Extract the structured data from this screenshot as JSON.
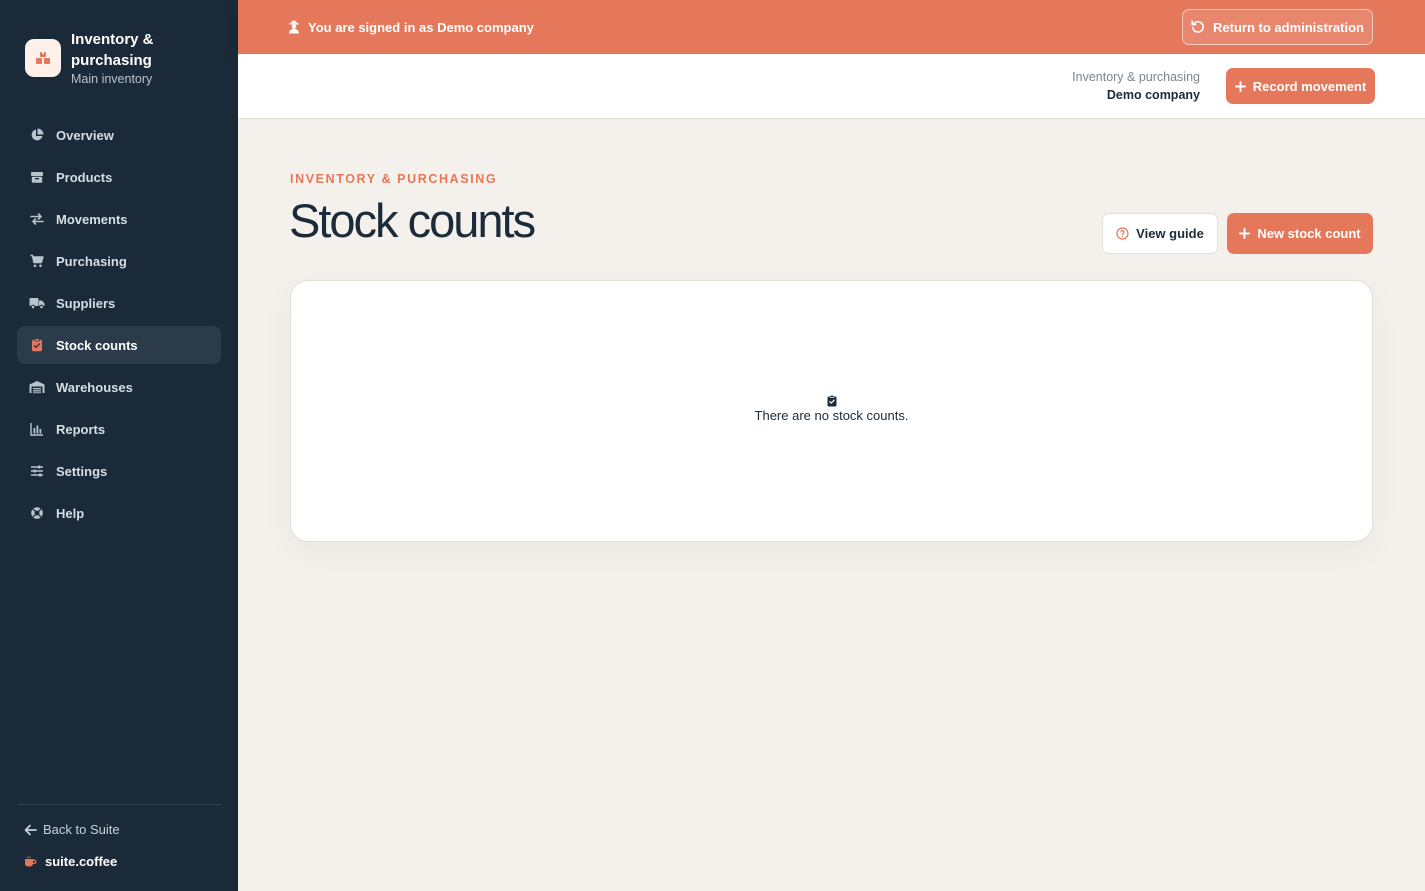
{
  "brand": {
    "title": "Inventory & purchasing",
    "subtitle": "Main inventory",
    "logo_icon": "boxes-icon"
  },
  "sidebar": {
    "items": [
      {
        "label": "Overview",
        "icon": "pie-chart-icon",
        "active": false
      },
      {
        "label": "Products",
        "icon": "box-icon",
        "active": false
      },
      {
        "label": "Movements",
        "icon": "arrows-left-right-icon",
        "active": false
      },
      {
        "label": "Purchasing",
        "icon": "cart-icon",
        "active": false
      },
      {
        "label": "Suppliers",
        "icon": "truck-icon",
        "active": false
      },
      {
        "label": "Stock counts",
        "icon": "clipboard-check-icon",
        "active": true
      },
      {
        "label": "Warehouses",
        "icon": "warehouse-icon",
        "active": false
      },
      {
        "label": "Reports",
        "icon": "bar-chart-icon",
        "active": false
      },
      {
        "label": "Settings",
        "icon": "sliders-icon",
        "active": false
      },
      {
        "label": "Help",
        "icon": "lifebuoy-icon",
        "active": false
      }
    ],
    "back_label": "Back to Suite",
    "suite_label": "suite.coffee"
  },
  "banner": {
    "text": "You are signed in as Demo company",
    "return_label": "Return to administration"
  },
  "topbar": {
    "app_name": "Inventory & purchasing",
    "company": "Demo company",
    "record_label": "Record movement"
  },
  "page": {
    "eyebrow": "INVENTORY & PURCHASING",
    "title": "Stock counts",
    "guide_label": "View guide",
    "new_label": "New stock count",
    "empty_text": "There are no stock counts."
  },
  "colors": {
    "accent": "#e5775a",
    "sidebar_bg": "#1b2a38",
    "page_bg": "#f4f1ec"
  }
}
